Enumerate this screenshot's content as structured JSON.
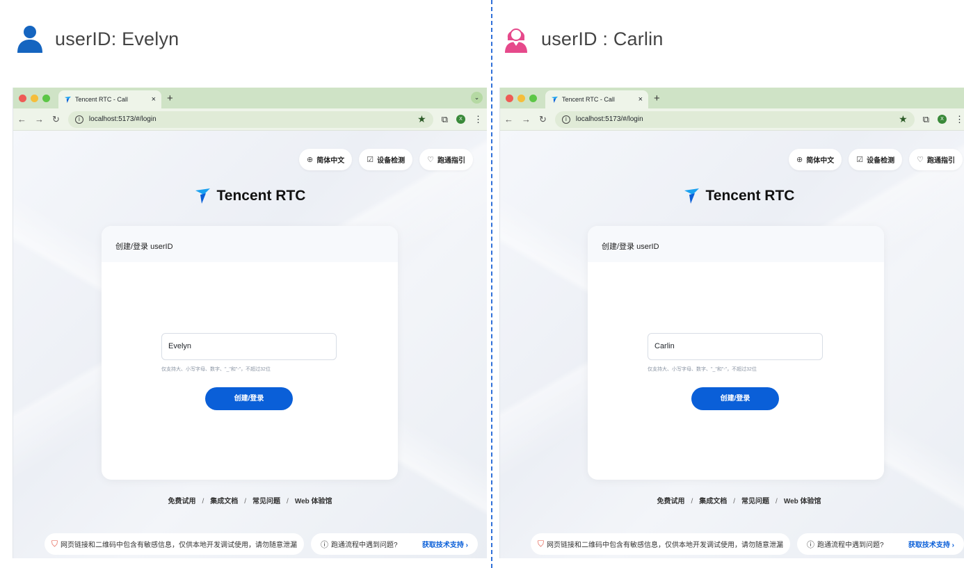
{
  "left": {
    "user_label": "userID: Evelyn",
    "input_value": "Evelyn"
  },
  "right": {
    "user_label": "userID : Carlin",
    "input_value": "Carlin"
  },
  "browser": {
    "tab_title": "Tencent RTC - Call",
    "tab_close": "×",
    "new_tab": "+",
    "url": "localhost:5173/#/login",
    "profile_initial": "X"
  },
  "app": {
    "lang_button": "简体中文",
    "device_button": "设备检测",
    "guide_button": "跑通指引",
    "brand": "Tencent RTC",
    "card_title": "创建/登录 userID",
    "hint": "仅支持大、小写字母、数字、\"_\"和\"-\"，不超过32位",
    "submit": "创建/登录",
    "links": [
      "免费试用",
      "集成文档",
      "常见问题",
      "Web 体验馆"
    ],
    "link_sep": "/",
    "warning": "网页链接和二维码中包含有敏感信息，仅供本地开发调试使用，请勿随意泄漏",
    "support_question": "跑通流程中遇到问题?",
    "support_cta": "获取技术支持 ›"
  },
  "colors": {
    "accent": "#0a5fd8",
    "divider": "#2f6fd8",
    "male_avatar": "#1565c0",
    "female_avatar": "#e6498b",
    "tabbar": "#cfe3c6"
  }
}
